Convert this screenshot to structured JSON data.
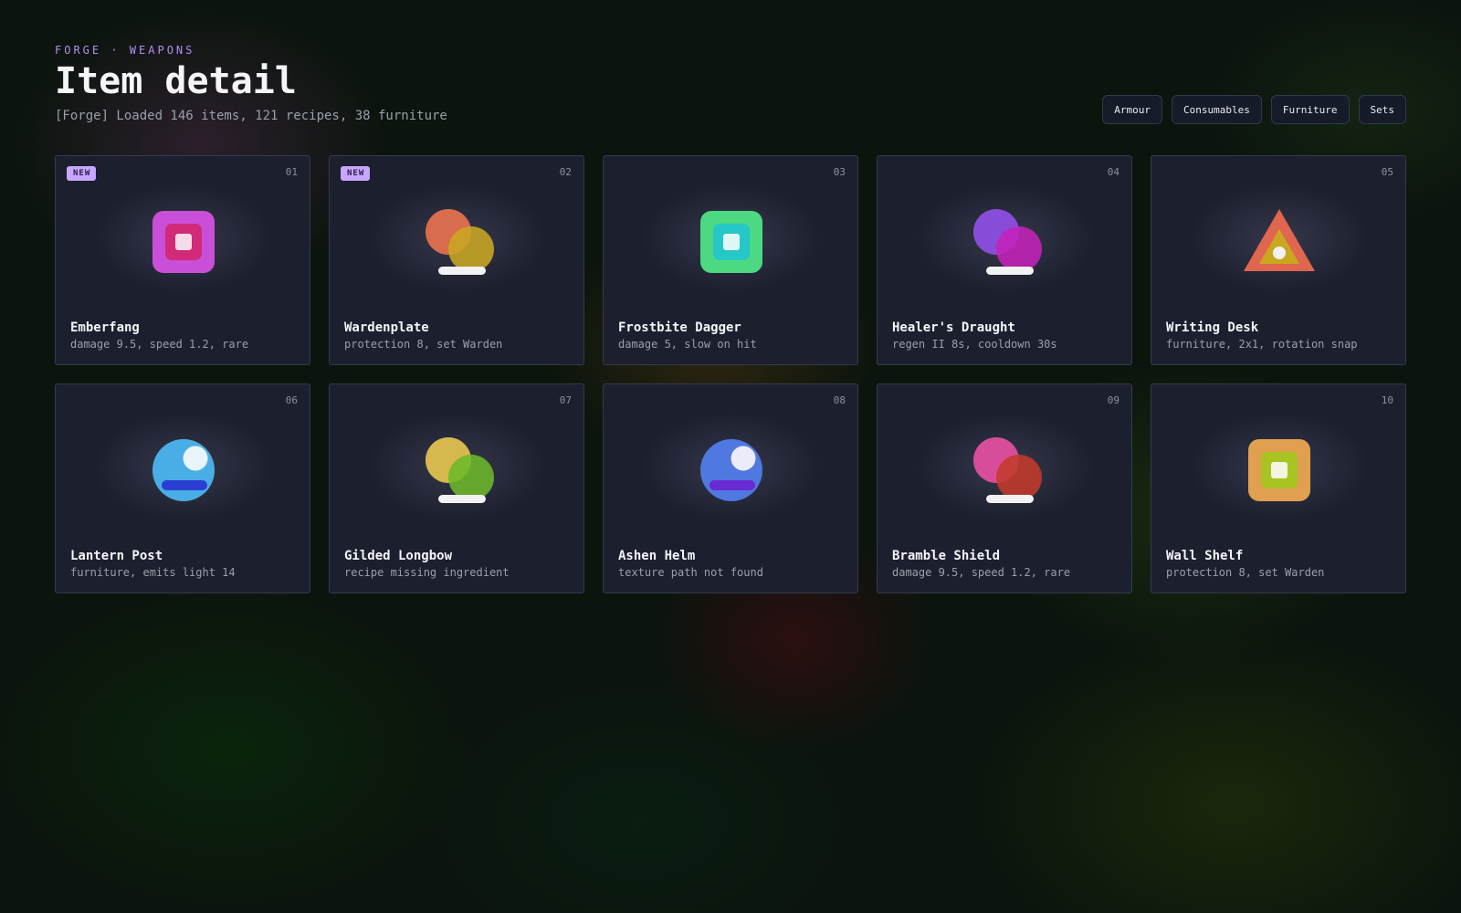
{
  "header": {
    "eyebrow": "FORGE · WEAPONS",
    "title": "Item detail",
    "subtitle": "[Forge] Loaded 146 items, 121 recipes, 38 furniture"
  },
  "filters": [
    "Armour",
    "Consumables",
    "Furniture",
    "Sets"
  ],
  "items": [
    {
      "num": "01",
      "badge": "NEW",
      "name": "Emberfang",
      "desc": "damage 9.5, speed 1.2, rare",
      "icon": "square-gem-icon",
      "colors": [
        "#c94fd9",
        "#d12a78",
        "#f4dbe8"
      ]
    },
    {
      "num": "02",
      "badge": "NEW",
      "name": "Wardenplate",
      "desc": "protection 8, set Warden",
      "icon": "orbs-icon",
      "colors": [
        "#e3704f",
        "#c9a722",
        "#f2f2f2"
      ]
    },
    {
      "num": "03",
      "badge": "",
      "name": "Frostbite Dagger",
      "desc": "damage 5, slow on hit",
      "icon": "square-gem-icon",
      "colors": [
        "#4cd981",
        "#25c7c7",
        "#dff7f5"
      ]
    },
    {
      "num": "04",
      "badge": "",
      "name": "Healer's Draught",
      "desc": "regen II 8s, cooldown 30s",
      "icon": "orbs-icon",
      "colors": [
        "#8d4fe0",
        "#c422b8",
        "#f2f2f2"
      ]
    },
    {
      "num": "05",
      "badge": "",
      "name": "Writing Desk",
      "desc": "furniture, 2x1, rotation snap",
      "icon": "triangle-icon",
      "colors": [
        "#e06650",
        "#c9a820",
        "#f2f2f2"
      ]
    },
    {
      "num": "06",
      "badge": "",
      "name": "Lantern Post",
      "desc": "furniture, emits light 14",
      "icon": "circle-bar-icon",
      "colors": [
        "#4aaee6",
        "#2a3fd1",
        "#e9f4fb"
      ]
    },
    {
      "num": "07",
      "badge": "",
      "name": "Gilded Longbow",
      "desc": "recipe missing ingredient",
      "icon": "orbs-icon",
      "colors": [
        "#e0c04f",
        "#6cb82a",
        "#f2f2f2"
      ]
    },
    {
      "num": "08",
      "badge": "",
      "name": "Ashen Helm",
      "desc": "texture path not found",
      "icon": "circle-bar-icon",
      "colors": [
        "#4f78e0",
        "#6a2ad1",
        "#ecebfa"
      ]
    },
    {
      "num": "09",
      "badge": "",
      "name": "Bramble Shield",
      "desc": "damage 9.5, speed 1.2, rare",
      "icon": "orbs-icon",
      "colors": [
        "#e04f9e",
        "#c43a2a",
        "#f2f2f2"
      ]
    },
    {
      "num": "10",
      "badge": "",
      "name": "Wall Shelf",
      "desc": "protection 8, set Warden",
      "icon": "square-gem-icon",
      "colors": [
        "#e0a04f",
        "#a8c422",
        "#f4f4e0"
      ]
    }
  ]
}
